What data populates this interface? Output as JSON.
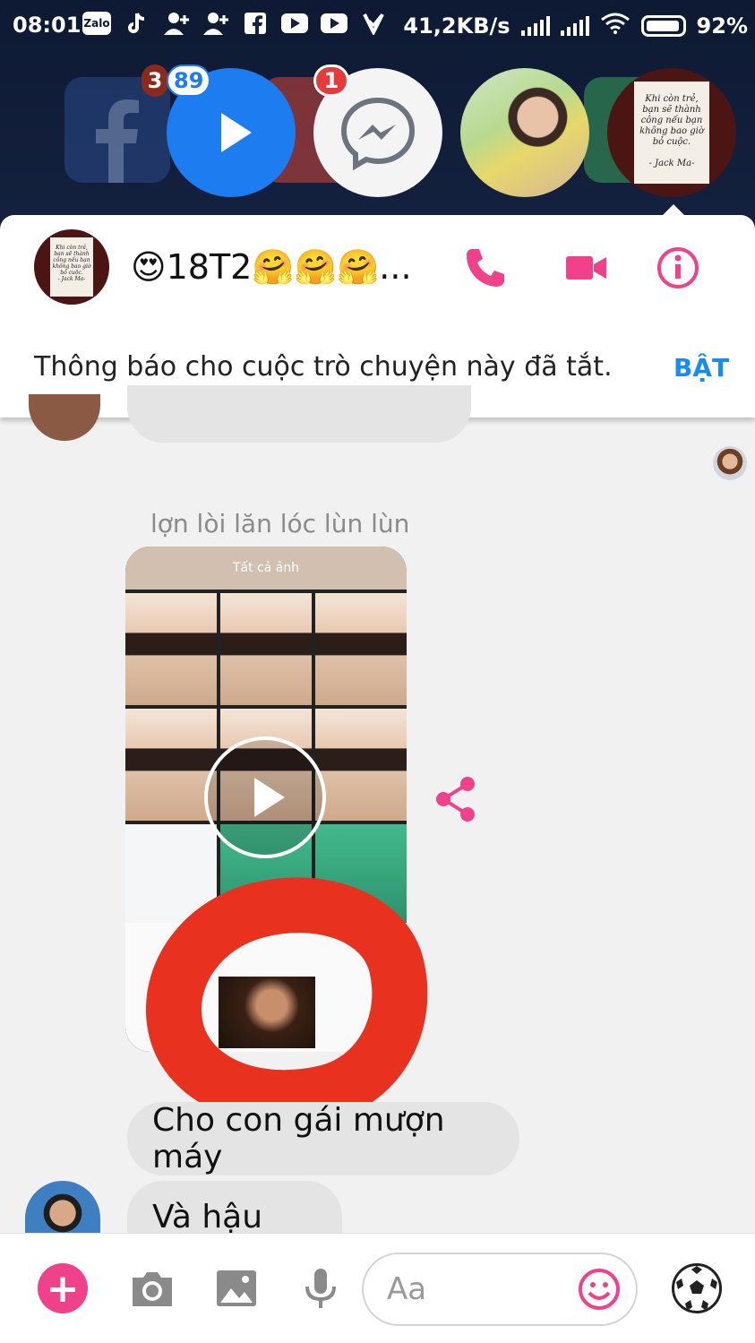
{
  "status_bar": {
    "time": "08:01",
    "notification_icons": [
      "zalo-icon",
      "tiktok-icon",
      "add-friend-icon",
      "add-friend-icon",
      "facebook-icon",
      "youtube-icon",
      "youtube-icon",
      "download-icon"
    ],
    "zalo_label": "Zalo",
    "network_speed": "41,2KB/s",
    "battery": "92%"
  },
  "chat_heads": {
    "video_badge": "89",
    "messenger_badge": "1",
    "behind_badge": "3",
    "quote_text": "Khi còn trẻ, bạn sẽ thành công nếu bạn không bao giờ bỏ cuộc.",
    "quote_author": "- Jack Ma-"
  },
  "conversation": {
    "title": "😍18T2🤗🤗🤗...",
    "notice": "Thông báo cho cuộc trò chuyện này đã tắt.",
    "turn_on_label": "BẬT",
    "avatar_quote": "Khi còn trẻ, bạn sẽ thành công nếu bạn không bao giờ bỏ cuộc.",
    "avatar_author": "- Jack Ma-"
  },
  "messages": {
    "caption": "lợn lòi lăn lóc lùn lùn",
    "video_header": "Tất cả ảnh",
    "bubble_1": "Cho con gái mượn máy",
    "bubble_2": "Và hậu quả"
  },
  "composer": {
    "placeholder": "Aa",
    "accent_color": "#f0428b",
    "link_color": "#1a8cf0"
  }
}
